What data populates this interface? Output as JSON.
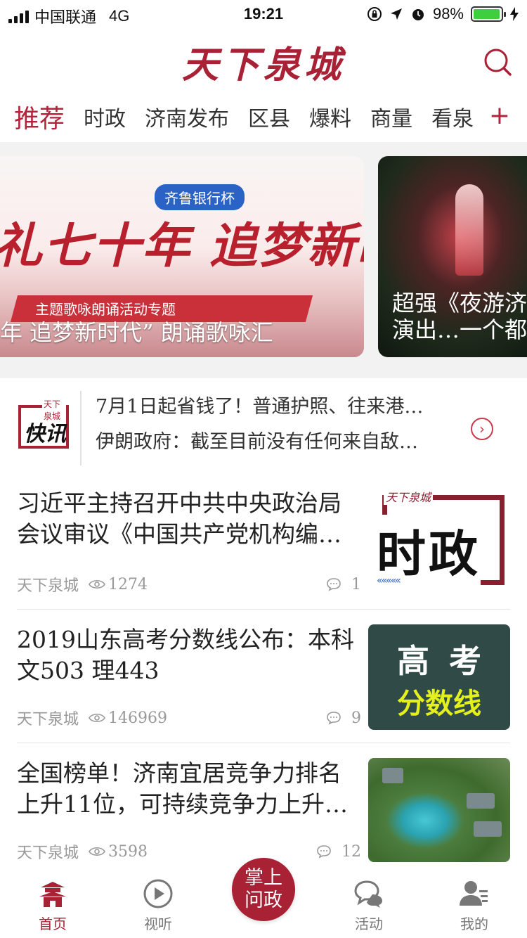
{
  "status_bar": {
    "carrier": "中国联通",
    "network": "4G",
    "time": "19:21",
    "battery_percent": "98%",
    "battery_level": 0.98
  },
  "header": {
    "logo_text": "天下泉城",
    "search_icon": "search-icon"
  },
  "tabs": {
    "items": [
      {
        "label": "推荐",
        "active": true
      },
      {
        "label": "时政"
      },
      {
        "label": "济南发布"
      },
      {
        "label": "区县"
      },
      {
        "label": "爆料"
      },
      {
        "label": "商量"
      },
      {
        "label": "看泉"
      }
    ],
    "add_label": "+"
  },
  "carousel": {
    "slides": [
      {
        "badge": "齐鲁银行杯",
        "headline": "礼七十年 追梦新时代",
        "subtitle": "主题歌咏朗诵活动专题",
        "caption": "年 追梦新时代” 朗诵歌咏汇"
      },
      {
        "caption_line1": "超强《夜游济",
        "caption_line2": "演出…一个都"
      }
    ]
  },
  "quick_news": {
    "logo_small": "天下泉城",
    "logo_big": "快讯",
    "items": [
      "7月1日起省钱了！普通护照、往来港…",
      "伊朗政府：截至目前没有任何来自敌…"
    ],
    "more_icon": "chevron-right-icon"
  },
  "articles": [
    {
      "title": "习近平主持召开中共中央政治局会议审议《中国共产党机构编…",
      "source": "天下泉城",
      "views": "1274",
      "comments": "1",
      "thumb": {
        "type": "shizheng",
        "mini": "天下泉城",
        "big": "时政",
        "chevrons": "«««««"
      }
    },
    {
      "title": "2019山东高考分数线公布：本科文503 理443",
      "source": "天下泉城",
      "views": "146969",
      "comments": "9",
      "thumb": {
        "type": "gaokao",
        "line1": "高考",
        "line2": "分数线"
      }
    },
    {
      "title": "全国榜单！济南宜居竞争力排名上升11位，可持续竞争力上升…",
      "source": "天下泉城",
      "views": "3598",
      "comments": "12",
      "thumb": {
        "type": "spring"
      }
    }
  ],
  "tab_bar": {
    "items": [
      {
        "label": "首页",
        "icon": "home-pagoda-icon",
        "active": true
      },
      {
        "label": "视听",
        "icon": "play-circle-icon"
      },
      {
        "label": "活动",
        "icon": "chat-bubbles-icon"
      },
      {
        "label": "我的",
        "icon": "user-icon"
      }
    ],
    "center_line1": "掌上",
    "center_line2": "问政"
  },
  "colors": {
    "brand": "#a82134",
    "accent_red": "#b3243a",
    "battery_green": "#3ecf3e",
    "gaokao_bg": "#2f4a47"
  }
}
